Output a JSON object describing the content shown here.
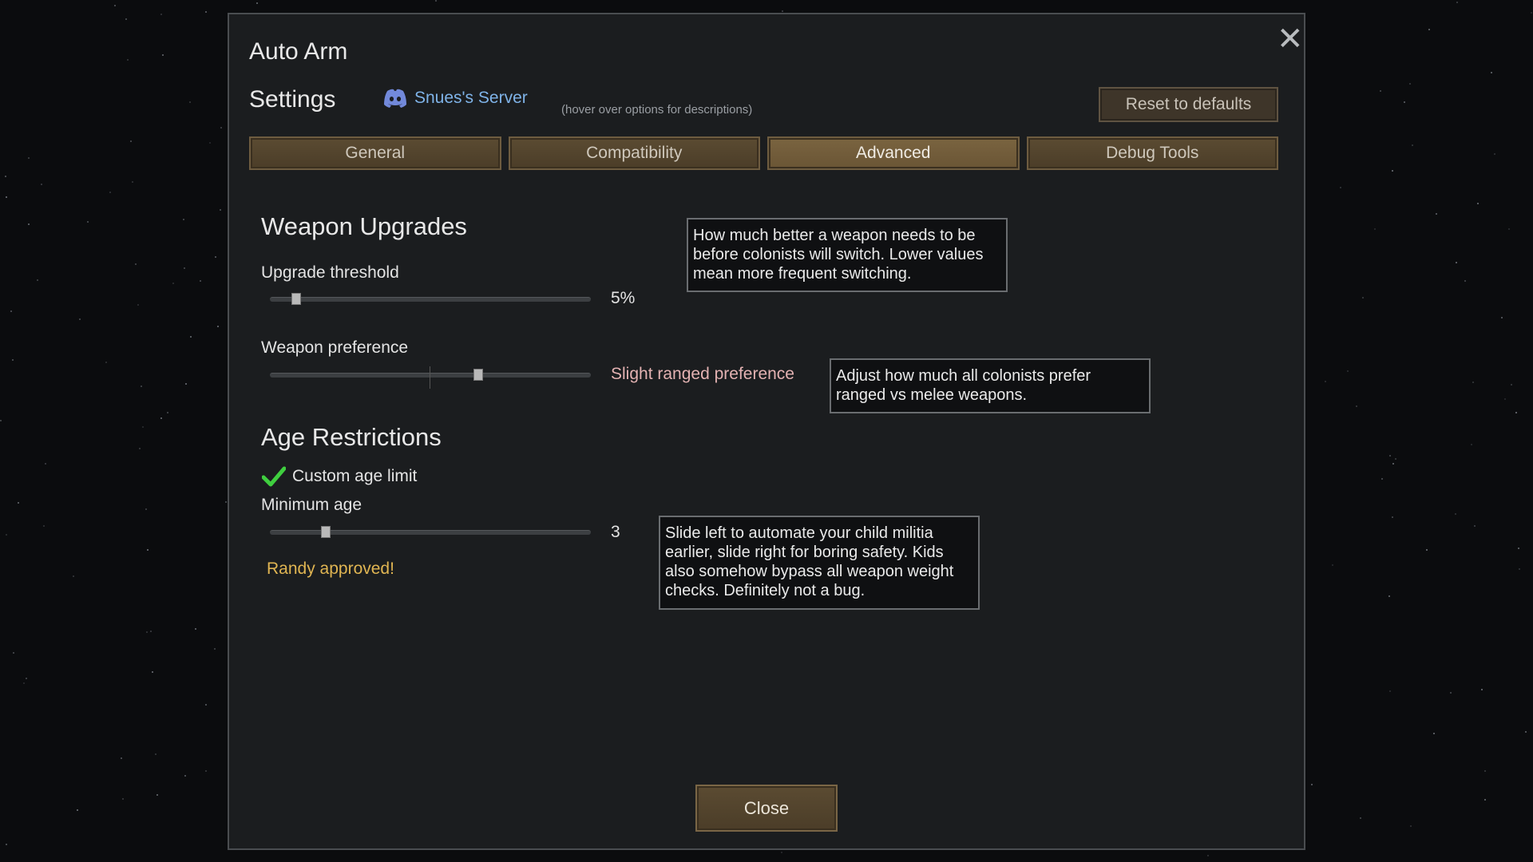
{
  "window": {
    "title": "Auto Arm",
    "close_icon": "close-icon"
  },
  "header": {
    "settings_label": "Settings",
    "discord_label": "Snues's Server",
    "discord_icon": "discord-icon",
    "hint": "(hover over options for descriptions)",
    "reset_label": "Reset to defaults"
  },
  "tabs": [
    {
      "label": "General",
      "active": false
    },
    {
      "label": "Compatibility",
      "active": false
    },
    {
      "label": "Advanced",
      "active": true
    },
    {
      "label": "Debug Tools",
      "active": false
    }
  ],
  "weapon_upgrades": {
    "title": "Weapon Upgrades",
    "upgrade_threshold": {
      "label": "Upgrade threshold",
      "value_text": "5%",
      "fraction": 0.05,
      "tooltip": "How much better a weapon needs to be before colonists will switch. Lower values mean more frequent switching."
    },
    "weapon_preference": {
      "label": "Weapon preference",
      "value_text": "Slight ranged preference",
      "fraction": 0.66,
      "tooltip": "Adjust how much all colonists prefer ranged vs melee weapons."
    }
  },
  "age_restrictions": {
    "title": "Age Restrictions",
    "custom_age_limit": {
      "label": "Custom age limit",
      "checked": true
    },
    "minimum_age": {
      "label": "Minimum age",
      "value_text": "3",
      "fraction": 0.15,
      "tooltip": "Slide left to automate your child militia earlier, slide right for boring safety. Kids also somehow bypass all weapon weight checks. Definitely not a bug."
    },
    "note": "Randy approved!"
  },
  "footer": {
    "close_label": "Close"
  },
  "colors": {
    "accent_link": "#7fb3e8",
    "note_text": "#e0b552",
    "preference_text": "#e3b2b2",
    "check_green": "#3fcf3f"
  }
}
